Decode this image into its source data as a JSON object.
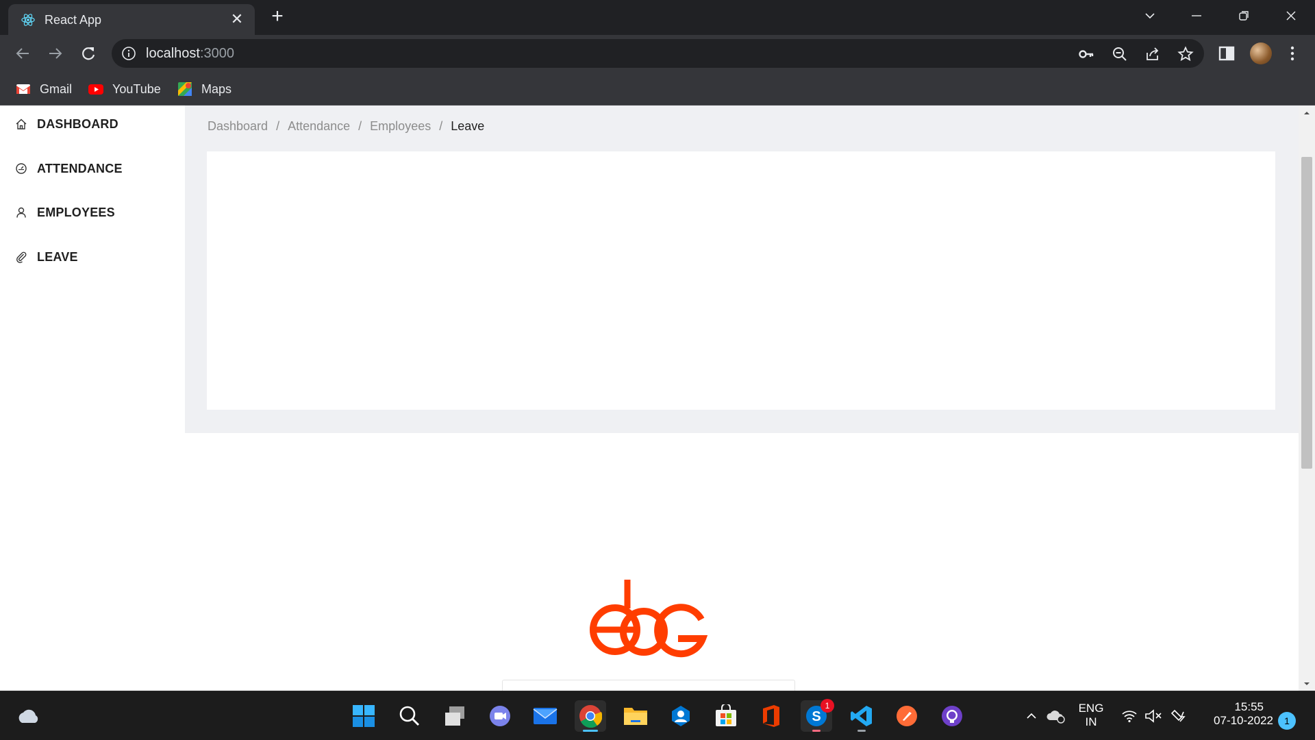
{
  "browser": {
    "tab_title": "React App",
    "url_host": "localhost",
    "url_port": ":3000",
    "bookmarks": [
      {
        "label": "Gmail",
        "icon": "gmail-icon"
      },
      {
        "label": "YouTube",
        "icon": "youtube-icon"
      },
      {
        "label": "Maps",
        "icon": "maps-icon"
      }
    ]
  },
  "sidebar": {
    "items": [
      {
        "label": "DASHBOARD",
        "icon": "home-icon"
      },
      {
        "label": "ATTENDANCE",
        "icon": "dashboard-gauge-icon"
      },
      {
        "label": "EMPLOYEES",
        "icon": "user-icon"
      },
      {
        "label": "LEAVE",
        "icon": "paperclip-icon"
      }
    ]
  },
  "breadcrumb": {
    "items": [
      "Dashboard",
      "Attendance",
      "Employees"
    ],
    "current": "Leave",
    "separator": "/"
  },
  "taskbar": {
    "apps": [
      "start",
      "search",
      "task-view",
      "teams-chat",
      "mail",
      "chrome",
      "file-explorer",
      "company-portal",
      "microsoft-store",
      "office",
      "skype",
      "vscode",
      "postman",
      "github-desktop"
    ],
    "skype_badge": "1",
    "lang_top": "ENG",
    "lang_bottom": "IN",
    "time": "15:55",
    "date": "07-10-2022",
    "notification_count": "1"
  },
  "colors": {
    "accent_logo": "#ff3d00",
    "content_bg": "#eff0f3",
    "chrome_dark": "#202124",
    "chrome_toolbar": "#35363a"
  }
}
